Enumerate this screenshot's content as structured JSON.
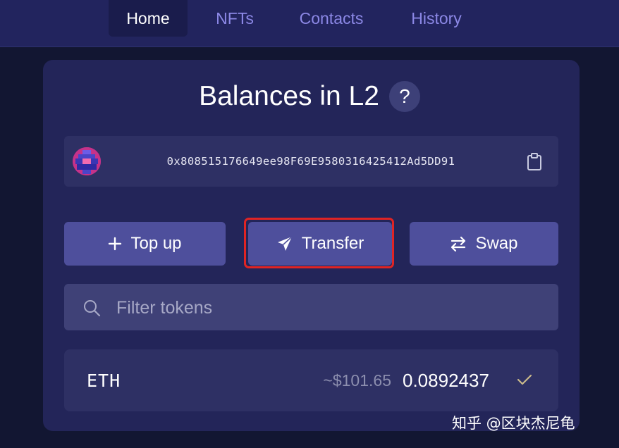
{
  "nav": {
    "tabs": [
      {
        "label": "Home",
        "active": true
      },
      {
        "label": "NFTs",
        "active": false
      },
      {
        "label": "Contacts",
        "active": false
      },
      {
        "label": "History",
        "active": false
      }
    ]
  },
  "balances": {
    "title": "Balances in L2",
    "help_label": "?",
    "address": "0x808515176649ee98F69E9580316425412Ad5DD91"
  },
  "actions": {
    "top_up_label": "Top up",
    "transfer_label": "Transfer",
    "swap_label": "Swap"
  },
  "filter": {
    "placeholder": "Filter tokens",
    "value": ""
  },
  "tokens": [
    {
      "symbol": "ETH",
      "usd": "~$101.65",
      "amount": "0.0892437",
      "verified": true
    }
  ],
  "watermark": "知乎 @区块杰尼龟",
  "icons": {
    "help": "help-icon",
    "copy": "clipboard-icon",
    "top_up": "plus-icon",
    "transfer": "send-icon",
    "swap": "swap-arrows-icon",
    "search": "search-icon",
    "check": "check-icon"
  },
  "colors": {
    "background": "#121632",
    "card": "#232559",
    "button": "#4e4f9c",
    "tab_inactive": "#8c88e6",
    "highlight": "#e02424",
    "check": "#c9b98a"
  }
}
